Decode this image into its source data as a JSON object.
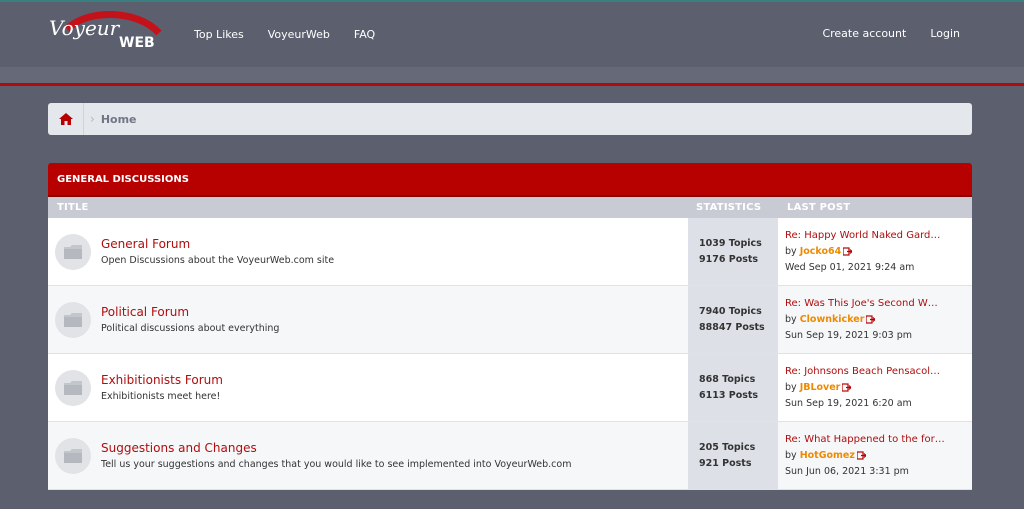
{
  "header": {
    "logo_text_1": "Voyeur",
    "logo_text_2": "WEB",
    "nav": [
      "Top Likes",
      "VoyeurWeb",
      "FAQ"
    ],
    "create_account": "Create account",
    "login": "Login"
  },
  "breadcrumb": {
    "home": "Home"
  },
  "category": {
    "title": "GENERAL DISCUSSIONS",
    "columns": {
      "title": "TITLE",
      "statistics": "STATISTICS",
      "last_post": "LAST POST"
    },
    "forums": [
      {
        "name": "General Forum",
        "description": "Open Discussions about the VoyeurWeb.com site",
        "topics": "1039 Topics",
        "posts": "9176 Posts",
        "last_title": "Re: Happy World Naked Gard…",
        "by": "by",
        "user": "Jocko64",
        "date": "Wed Sep 01, 2021 9:24 am"
      },
      {
        "name": "Political Forum",
        "description": "Political discussions about everything",
        "topics": "7940 Topics",
        "posts": "88847 Posts",
        "last_title": "Re: Was This Joe's Second W…",
        "by": "by",
        "user": "Clownkicker",
        "date": "Sun Sep 19, 2021 9:03 pm"
      },
      {
        "name": "Exhibitionists Forum",
        "description": "Exhibitionists meet here!",
        "topics": "868 Topics",
        "posts": "6113 Posts",
        "last_title": "Re: Johnsons Beach Pensacol…",
        "by": "by",
        "user": "JBLover",
        "date": "Sun Sep 19, 2021 6:20 am"
      },
      {
        "name": "Suggestions and Changes",
        "description": "Tell us your suggestions and changes that you would like to see implemented into VoyeurWeb.com",
        "topics": "205 Topics",
        "posts": "921 Posts",
        "last_title": "Re: What Happened to the for…",
        "by": "by",
        "user": "HotGomez",
        "date": "Sun Jun 06, 2021 3:31 pm"
      }
    ]
  },
  "colors": {
    "brand_red": "#b70000",
    "user_orange": "#ee8a00",
    "nav_bg": "#5c5f6e"
  },
  "icons": [
    "home-icon",
    "folder-icon",
    "goto-post-icon"
  ]
}
